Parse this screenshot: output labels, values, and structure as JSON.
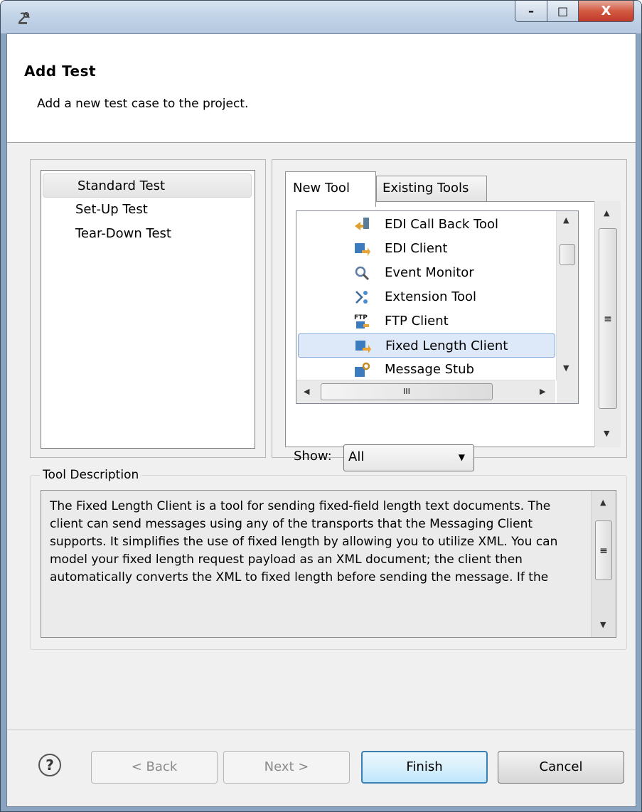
{
  "window": {
    "close_glyph": "X",
    "min_glyph": "–",
    "max_glyph": "□",
    "app_icon": "satellite-dish-icon"
  },
  "header": {
    "title": "Add Test",
    "description": "Add a new test case to the project."
  },
  "test_types": [
    {
      "label": "Standard Test",
      "selected": true
    },
    {
      "label": "Set-Up Test",
      "selected": false
    },
    {
      "label": "Tear-Down Test",
      "selected": false
    }
  ],
  "tabs": {
    "active": "New Tool",
    "inactive": "Existing Tools"
  },
  "tools": [
    {
      "label": "EDI Call Back Tool",
      "icon": "callback-arrow-icon"
    },
    {
      "label": "EDI Client",
      "icon": "client-icon"
    },
    {
      "label": "Event Monitor",
      "icon": "magnifier-icon"
    },
    {
      "label": "Extension Tool",
      "icon": "extension-icon"
    },
    {
      "label": "FTP Client",
      "icon": "ftp-icon"
    },
    {
      "label": "Fixed Length Client",
      "icon": "client-icon",
      "selected": true
    },
    {
      "label": "Message Stub",
      "icon": "gear-stub-icon"
    }
  ],
  "scroll_glyphs": {
    "up": "▲",
    "down": "▼",
    "left": "◀",
    "right": "▶",
    "grip": "≡",
    "hgrip": "III"
  },
  "show": {
    "label": "Show:",
    "value": "All"
  },
  "description": {
    "legend": "Tool Description",
    "text": "The Fixed Length Client is a tool for sending fixed-field length text documents.  The client can send messages using any of the transports that the Messaging Client supports.  It simplifies the use of fixed length by allowing you to utilize XML.  You can model your fixed length request payload as an XML document; the client then automatically converts the XML to fixed length before sending the message.  If the"
  },
  "buttons": {
    "help": "?",
    "back": "< Back",
    "next": "Next >",
    "finish": "Finish",
    "cancel": "Cancel"
  }
}
